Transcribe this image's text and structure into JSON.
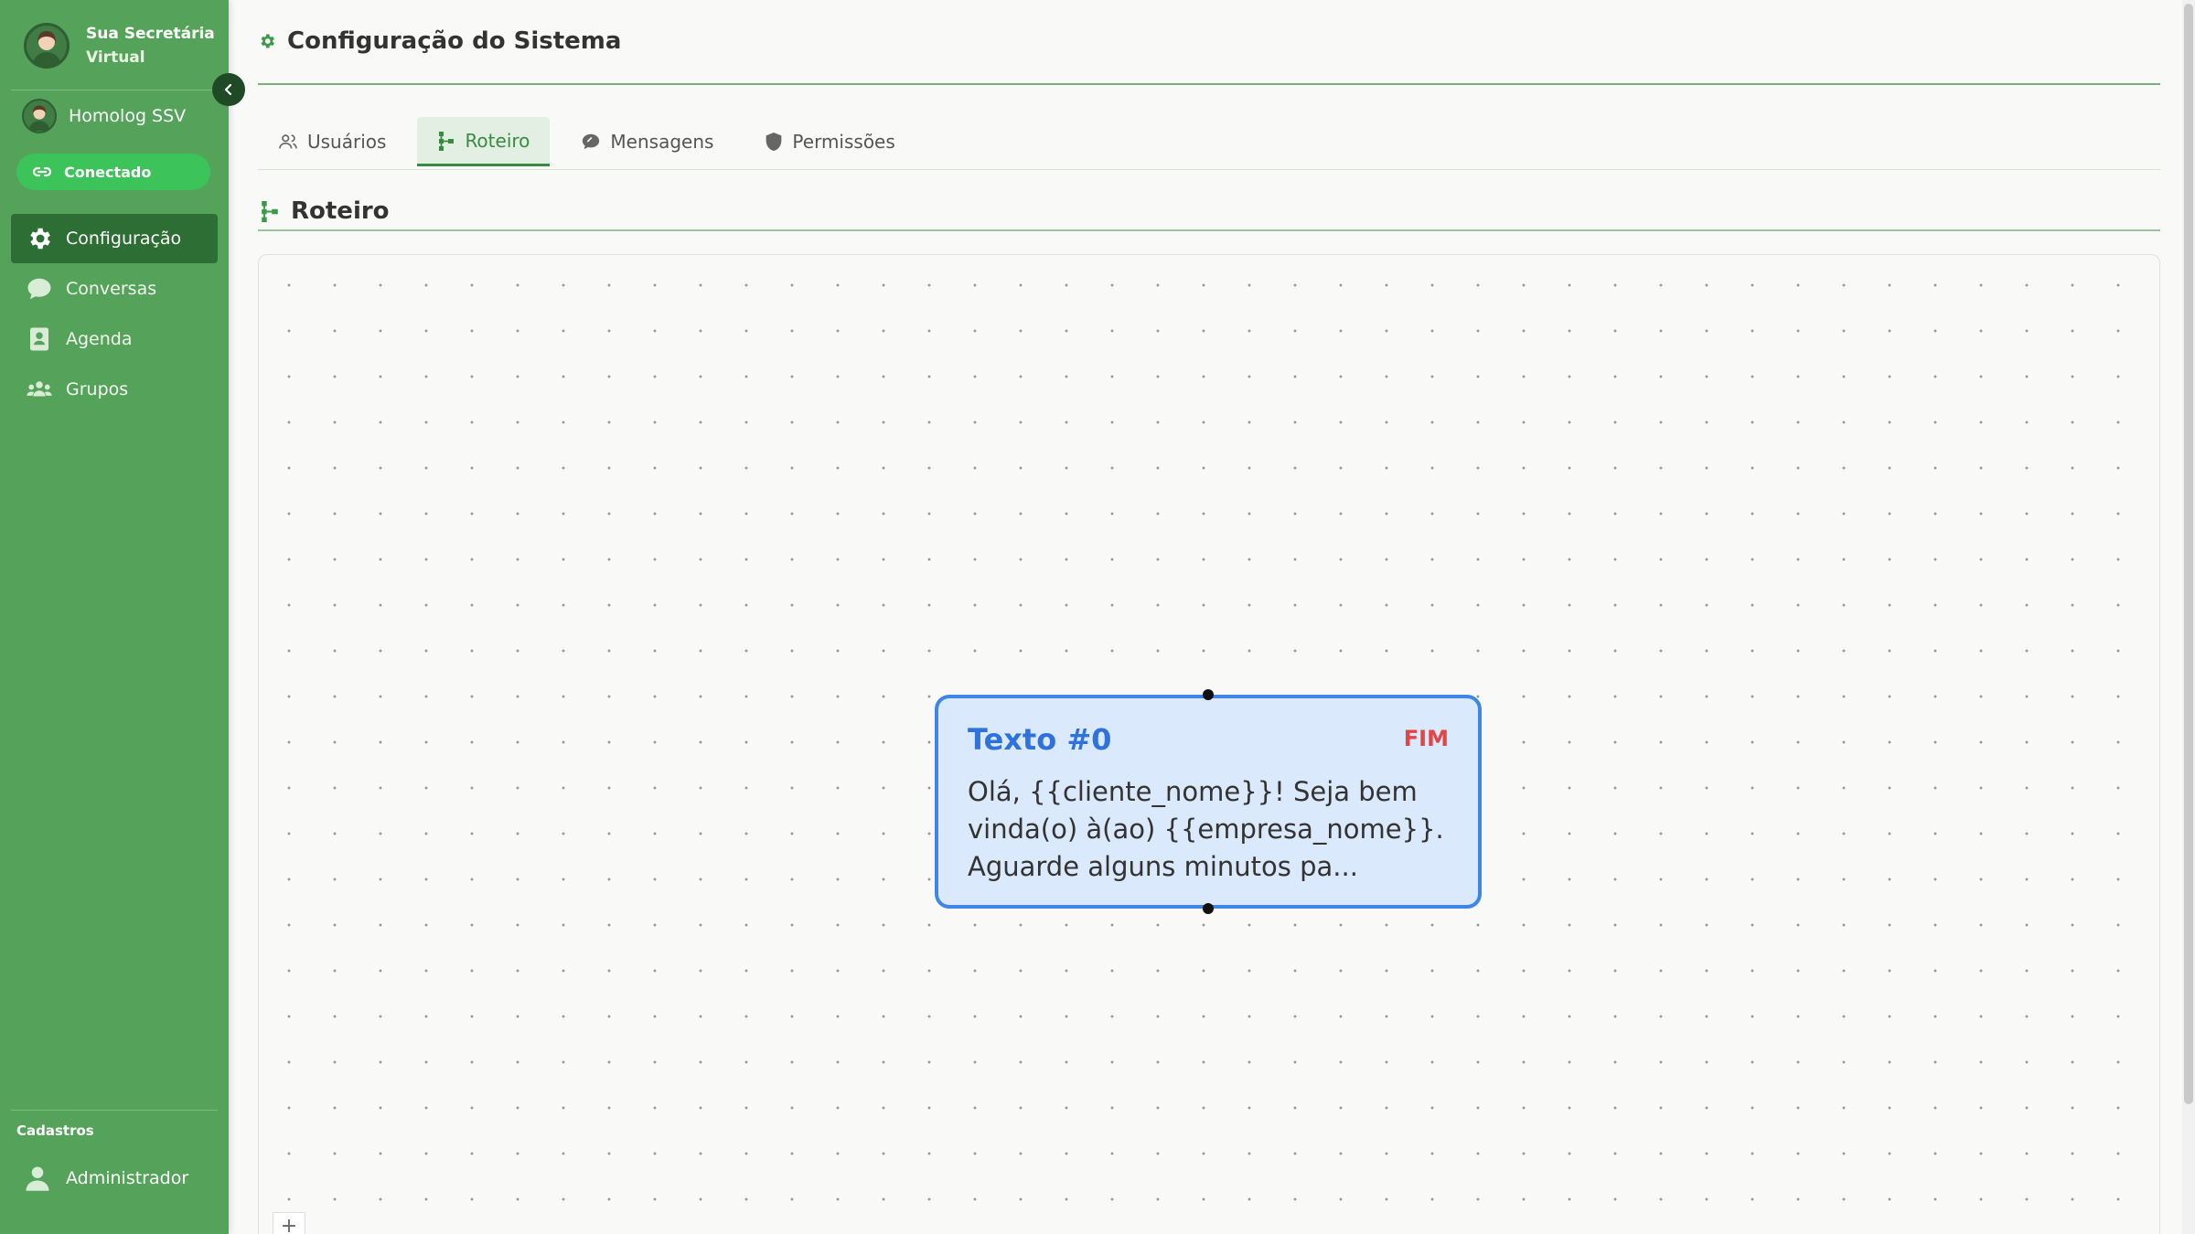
{
  "sidebar": {
    "brand_line1": "Sua Secretária",
    "brand_line2": "Virtual",
    "workspace_name": "Homolog SSV",
    "status_label": "Conectado",
    "nav": [
      {
        "label": "Configuração",
        "icon": "gear-icon",
        "active": true
      },
      {
        "label": "Conversas",
        "icon": "chat-bubble-icon"
      },
      {
        "label": "Agenda",
        "icon": "contact-book-icon"
      },
      {
        "label": "Grupos",
        "icon": "group-icon"
      }
    ],
    "section_label": "Cadastros",
    "admin_label": "Administrador"
  },
  "header": {
    "title": "Configuração do Sistema"
  },
  "tabs": [
    {
      "label": "Usuários",
      "icon": "users-icon"
    },
    {
      "label": "Roteiro",
      "icon": "flow-icon",
      "active": true
    },
    {
      "label": "Mensagens",
      "icon": "chat-icon"
    },
    {
      "label": "Permissões",
      "icon": "shield-icon"
    }
  ],
  "section": {
    "title": "Roteiro"
  },
  "node": {
    "title": "Texto #0",
    "badge": "FIM",
    "body": "Olá, {{cliente_nome}}! Seja bem vinda(o) à(ao) {{empresa_nome}}. Aguarde alguns minutos pa..."
  },
  "canvas": {
    "zoom_in_label": "+"
  },
  "colors": {
    "sidebar_bg": "#55a35a",
    "active_nav": "#2d6e35",
    "status_pill": "#3cc35a",
    "node_border": "#3e86e8",
    "node_bg": "#dbe9fc",
    "badge": "#e24545"
  }
}
